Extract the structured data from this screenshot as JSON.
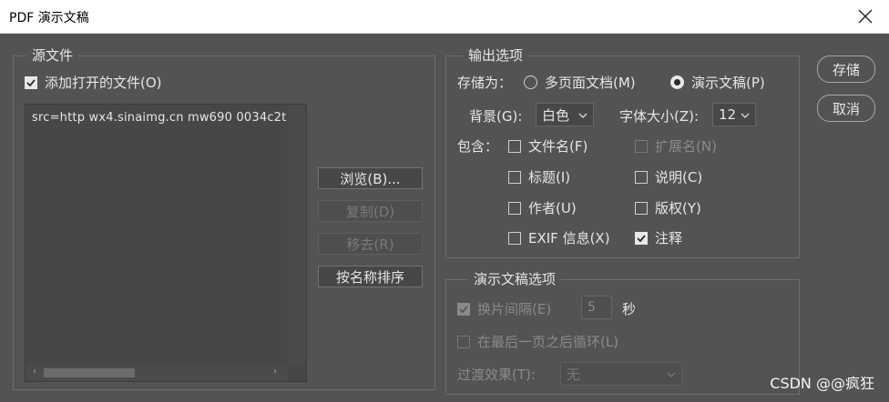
{
  "window": {
    "title": "PDF 演示文稿"
  },
  "source": {
    "group_title": "源文件",
    "add_open_files": {
      "label": "添加打开的文件(O)",
      "checked": true
    },
    "file_list": [
      "src=http     wx4.sinaimg.cn  mw690  0034c2t"
    ],
    "buttons": {
      "browse": "浏览(B)...",
      "duplicate": "复制(D)",
      "remove": "移去(R)",
      "sort": "按名称排序"
    }
  },
  "output": {
    "group_title": "输出选项",
    "save_as_label": "存储为：",
    "save_as_options": [
      {
        "label": "多页面文档(M)",
        "selected": false
      },
      {
        "label": "演示文稿(P)",
        "selected": true
      }
    ],
    "background_label": "背景(G):",
    "background_value": "白色",
    "font_size_label": "字体大小(Z):",
    "font_size_value": "12",
    "include_label": "包含：",
    "include": {
      "filename": {
        "label": "文件名(F)",
        "checked": false
      },
      "extension": {
        "label": "扩展名(N)",
        "checked": false,
        "disabled": true
      },
      "title": {
        "label": "标题(I)",
        "checked": false
      },
      "description": {
        "label": "说明(C)",
        "checked": false
      },
      "author": {
        "label": "作者(U)",
        "checked": false
      },
      "copyright": {
        "label": "版权(Y)",
        "checked": false
      },
      "exif": {
        "label": "EXIF 信息(X)",
        "checked": false
      },
      "annotations": {
        "label": "注释",
        "checked": true
      }
    }
  },
  "presentation": {
    "group_title": "演示文稿选项",
    "advance": {
      "label": "换片间隔(E)",
      "checked": true,
      "disabled": true
    },
    "advance_value": "5",
    "seconds_label": "秒",
    "loop": {
      "label": "在最后一页之后循环(L)",
      "checked": false,
      "disabled": true
    },
    "transition_label": "过渡效果(T):",
    "transition_value": "无"
  },
  "actions": {
    "save": "存储",
    "cancel": "取消"
  },
  "watermark": "CSDN @@疯狂"
}
